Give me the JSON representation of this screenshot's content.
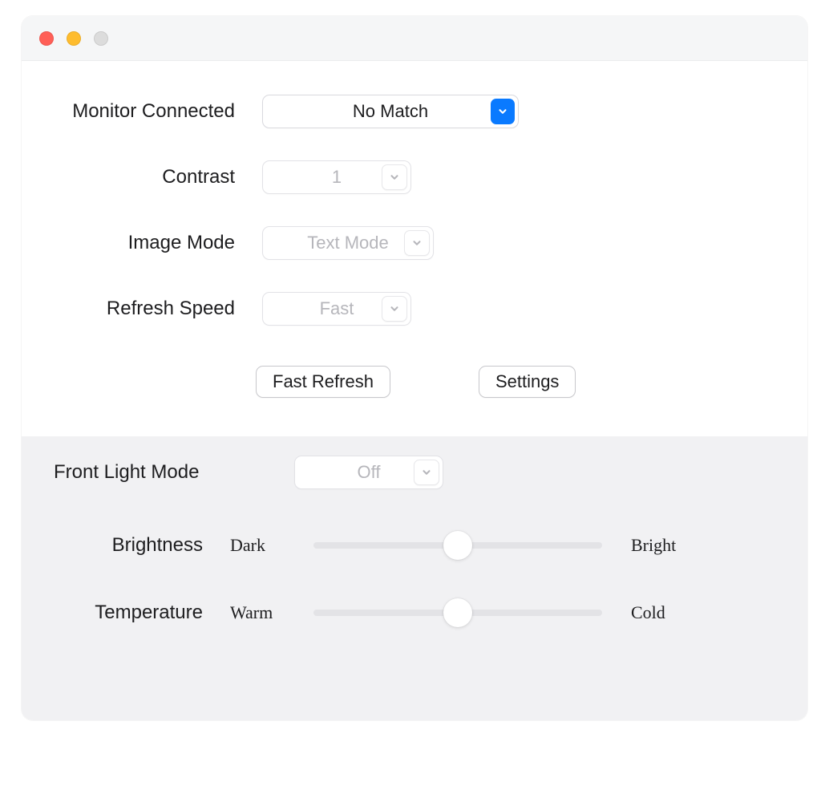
{
  "fields": {
    "monitor": {
      "label": "Monitor Connected",
      "value": "No Match"
    },
    "contrast": {
      "label": "Contrast",
      "value": "1"
    },
    "imageMode": {
      "label": "Image Mode",
      "value": "Text Mode"
    },
    "refreshSpeed": {
      "label": "Refresh Speed",
      "value": "Fast"
    },
    "frontLight": {
      "label": "Front Light Mode",
      "value": "Off"
    }
  },
  "buttons": {
    "fastRefresh": "Fast Refresh",
    "settings": "Settings"
  },
  "sliders": {
    "brightness": {
      "label": "Brightness",
      "left": "Dark",
      "right": "Bright"
    },
    "temperature": {
      "label": "Temperature",
      "left": "Warm",
      "right": "Cold"
    }
  }
}
